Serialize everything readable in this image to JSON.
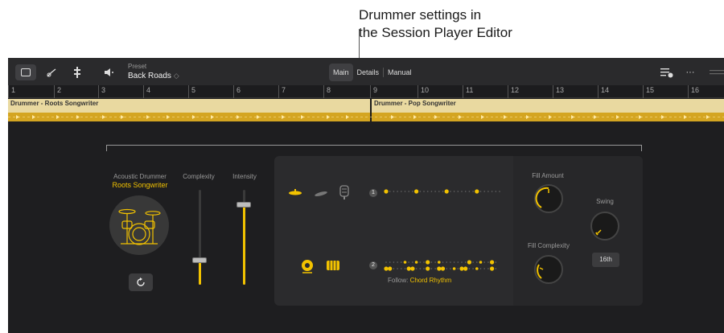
{
  "callout": {
    "line1": "Drummer settings in",
    "line2": "the Session Player Editor"
  },
  "toolbar": {
    "preset_label": "Preset",
    "preset_value": "Back Roads",
    "preset_chevron": "◇",
    "tabs": [
      "Main",
      "Details",
      "Manual"
    ],
    "active_tab": "Main",
    "more_label": "···"
  },
  "ruler": {
    "bars": [
      "1",
      "2",
      "3",
      "4",
      "5",
      "6",
      "7",
      "8",
      "9",
      "10",
      "11",
      "12",
      "13",
      "14",
      "15",
      "16"
    ]
  },
  "track": {
    "regions": [
      "Drummer - Roots Songwriter",
      "Drummer - Pop Songwriter"
    ]
  },
  "drummer": {
    "label": "Acoustic Drummer",
    "name": "Roots Songwriter"
  },
  "sliders": {
    "complexity_label": "Complexity",
    "complexity_value": 0.26,
    "intensity_label": "Intensity",
    "intensity_value": 0.85
  },
  "rows": {
    "row1_number": "1",
    "row2_number": "2",
    "follow_label": "Follow:",
    "follow_value": "Chord Rhythm"
  },
  "fills": {
    "fill_amount_label": "Fill Amount",
    "fill_complexity_label": "Fill Complexity",
    "swing_label": "Swing",
    "swing_resolution": "16th"
  },
  "colors": {
    "accent": "#f2c200",
    "region_light": "#e9d9a0",
    "region_dark": "#d4a521"
  }
}
